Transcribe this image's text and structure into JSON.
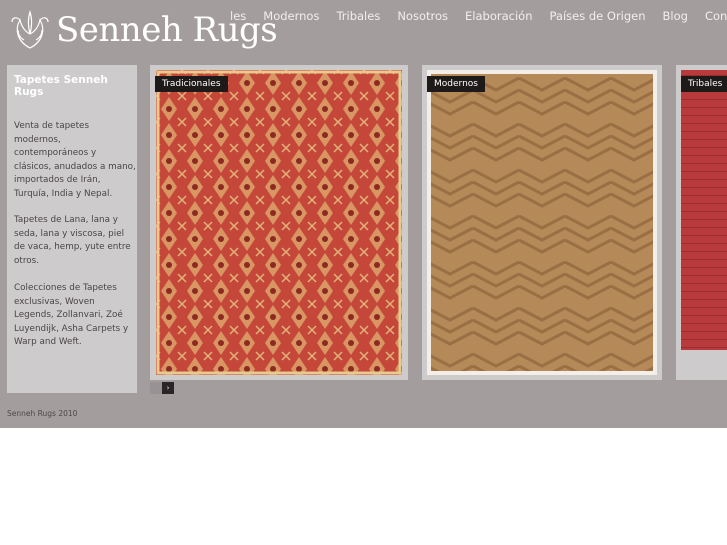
{
  "logo": {
    "text": "Senneh Rugs",
    "icon": "ornament-icon"
  },
  "nav": {
    "items": [
      "les",
      "Modernos",
      "Tribales",
      "Nosotros",
      "Elaboración",
      "Países de Origen",
      "Blog",
      "Contacto"
    ]
  },
  "sidebar": {
    "title": "Tapetes Senneh Rugs",
    "paragraphs": [
      "Venta de tapetes modernos, contemporáneos y clásicos, anudados a mano, importados de Irán, Turquía, India y Nepal.",
      "Tapetes de Lana, lana y seda, lana y viscosa, piel de vaca, hemp, yute entre otros.",
      "Colecciones de Tapetes exclusivas, Woven Legends, Zollanvari, Zoé Luyendijk, Asha Carpets y Warp and Weft."
    ]
  },
  "cards": [
    {
      "label": "Tradicionales"
    },
    {
      "label": "Modernos"
    },
    {
      "label": "Tribales"
    }
  ],
  "pager": {
    "next": "›"
  },
  "footer": {
    "text": "Senneh Rugs 2010"
  }
}
